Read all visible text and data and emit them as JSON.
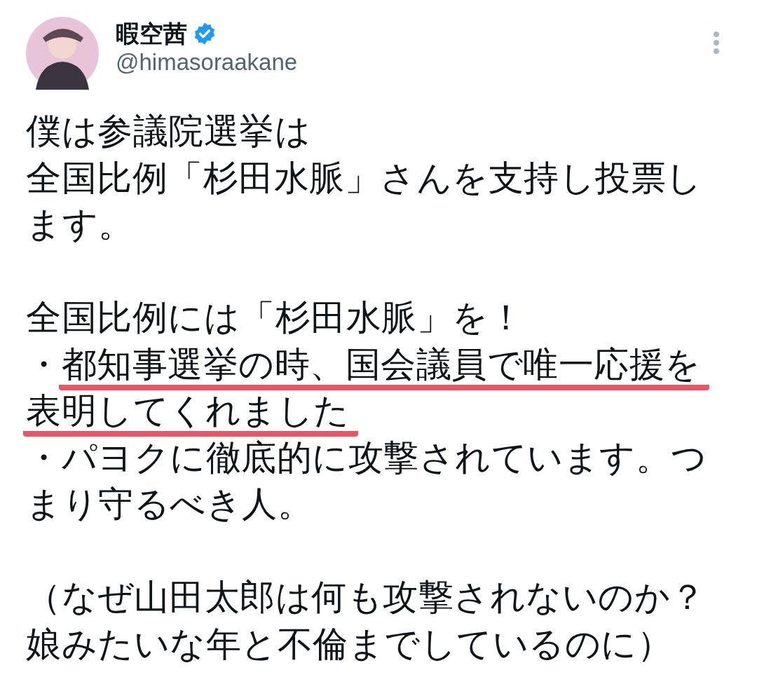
{
  "author": {
    "name": "暇空茜",
    "verified": true,
    "handle": "@himasoraakane"
  },
  "paragraphs": [
    [
      [
        {
          "text": "僕は参議院選挙は",
          "underlined": false
        }
      ],
      [
        {
          "text": "全国比例「杉田水脈」さんを支持し投票し",
          "underlined": false
        }
      ],
      [
        {
          "text": "ます。",
          "underlined": false
        }
      ]
    ],
    [
      [
        {
          "text": "全国比例には「杉田水脈」を！",
          "underlined": false
        }
      ],
      [
        {
          "text": "・",
          "underlined": false
        },
        {
          "text": "都知事選挙の時、国会議員で唯一応援を",
          "underlined": true
        }
      ],
      [
        {
          "text": "表明してくれました",
          "underlined": true
        }
      ],
      [
        {
          "text": "・パヨクに徹底的に攻撃されています。つ",
          "underlined": false
        }
      ],
      [
        {
          "text": "まり守るべき人。",
          "underlined": false
        }
      ]
    ],
    [
      [
        {
          "text": "（なぜ山田太郎は何も攻撃されないのか？",
          "underlined": false
        }
      ],
      [
        {
          "text": "娘みたいな年と不倫までしているのに）",
          "underlined": false
        }
      ]
    ]
  ]
}
